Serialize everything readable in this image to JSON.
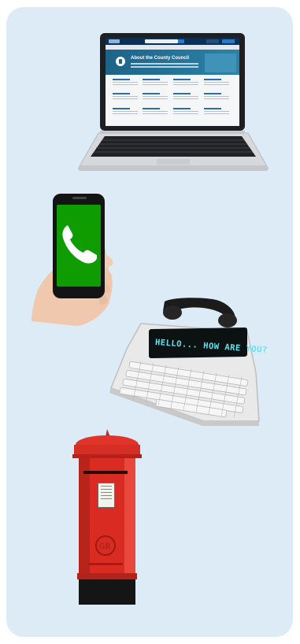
{
  "panel": {
    "background": "#dcebf6"
  },
  "laptop": {
    "website_heading": "About the County Council"
  },
  "mobile_phone": {
    "screen_color": "#0e9c00",
    "icon": "phone-handset-icon"
  },
  "textphone": {
    "display_text": "HELLO... HOW ARE YOU?",
    "display_text_color": "#59e6f2"
  },
  "postbox": {
    "color": "#d92b22",
    "cipher": "GR"
  }
}
